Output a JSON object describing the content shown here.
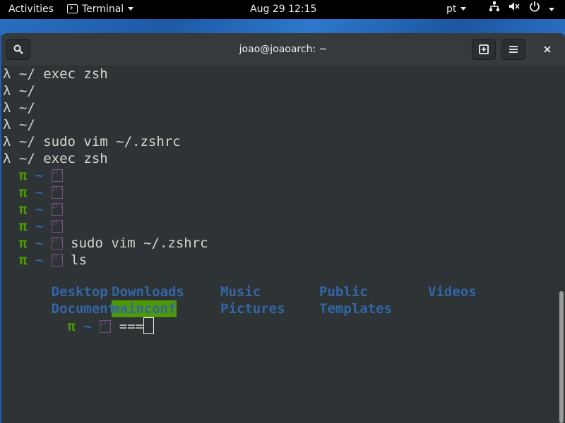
{
  "topbar": {
    "activities": "Activities",
    "app_name": "Terminal",
    "clock": "Aug 29  12:15",
    "language": "pt"
  },
  "window": {
    "title": "joao@joaoarch: ~"
  },
  "terminal": {
    "lambda_prompt": "λ ~/",
    "pi_prompt": "π",
    "pi_dir": "~",
    "missing_glyph_code": "27 6F",
    "lines": [
      {
        "kind": "lambda",
        "cmd": "exec zsh"
      },
      {
        "kind": "lambda",
        "cmd": ""
      },
      {
        "kind": "lambda",
        "cmd": ""
      },
      {
        "kind": "lambda",
        "cmd": ""
      },
      {
        "kind": "lambda",
        "cmd": "sudo vim ~/.zshrc"
      },
      {
        "kind": "lambda",
        "cmd": "exec zsh"
      },
      {
        "kind": "pi",
        "cmd": ""
      },
      {
        "kind": "pi",
        "cmd": ""
      },
      {
        "kind": "pi",
        "cmd": ""
      },
      {
        "kind": "pi",
        "cmd": ""
      },
      {
        "kind": "pi",
        "cmd": "sudo vim ~/.zshrc"
      },
      {
        "kind": "pi",
        "cmd": "ls"
      }
    ],
    "ls_row1": [
      "Desktop",
      "Downloads",
      "Music",
      "Public",
      "Videos"
    ],
    "ls_row2": [
      "Documents",
      "mainconf",
      "Pictures",
      "Templates"
    ],
    "current_input": "==="
  },
  "colors": {
    "prompt_pi": "#4e9a06",
    "directory": "#3465a4",
    "highlight_bg": "#4e9a06"
  }
}
